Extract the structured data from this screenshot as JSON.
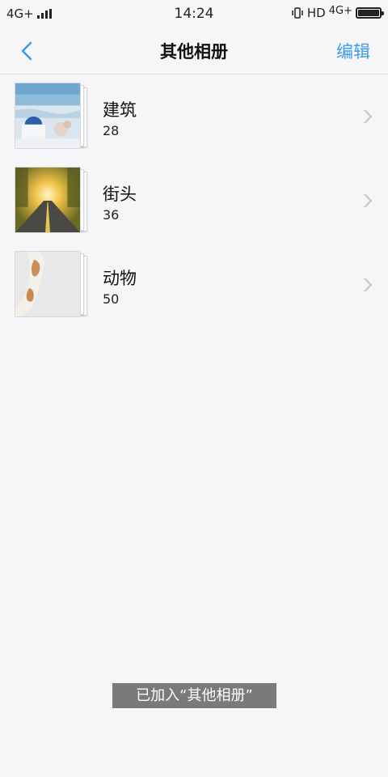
{
  "status_bar": {
    "network_left": "4G+",
    "time": "14:24",
    "hd_label": "HD",
    "network_right": "4G+"
  },
  "navbar": {
    "title": "其他相册",
    "edit_label": "编辑"
  },
  "albums": [
    {
      "name": "建筑",
      "count": "28",
      "thumbnail": "architecture-photo"
    },
    {
      "name": "街头",
      "count": "36",
      "thumbnail": "street-sunset-photo"
    },
    {
      "name": "动物",
      "count": "50",
      "thumbnail": "cat-tail-photo"
    }
  ],
  "toast": {
    "text": "已加入“其他相册”"
  },
  "colors": {
    "accent": "#3d9ce8",
    "background": "#f6f6f8",
    "toast_bg": "#7a7a7c"
  }
}
